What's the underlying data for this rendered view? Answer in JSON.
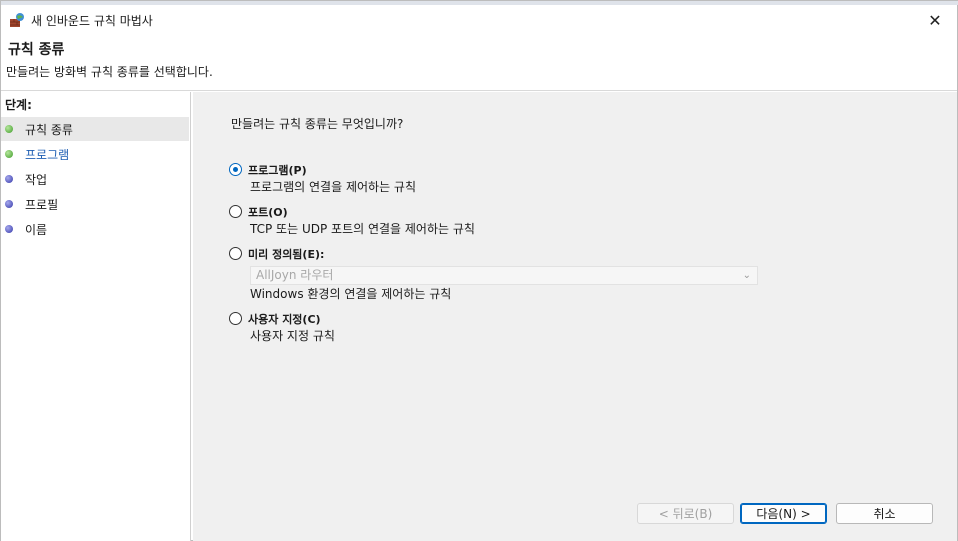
{
  "window": {
    "title": "새 인바운드 규칙 마법사",
    "close_label": "✕"
  },
  "header": {
    "title": "규칙 종류",
    "description": "만들려는 방화벽 규칙 종류를 선택합니다."
  },
  "steps": {
    "title": "단계:",
    "items": [
      {
        "label": "규칙 종류",
        "status": "done"
      },
      {
        "label": "프로그램",
        "status": "done"
      },
      {
        "label": "작업",
        "status": "pending"
      },
      {
        "label": "프로필",
        "status": "pending"
      },
      {
        "label": "이름",
        "status": "pending"
      }
    ]
  },
  "main": {
    "question": "만들려는 규칙 종류는 무엇입니까?",
    "options": [
      {
        "label": "프로그램(P)",
        "description": "프로그램의 연결을 제어하는 규칙",
        "checked": true
      },
      {
        "label": "포트(O)",
        "description": "TCP 또는 UDP 포트의 연결을 제어하는 규칙",
        "checked": false
      },
      {
        "label": "미리 정의됨(E):",
        "description": "Windows 환경의 연결을 제어하는 규칙",
        "checked": false
      },
      {
        "label": "사용자 지정(C)",
        "description": "사용자 지정 규칙",
        "checked": false
      }
    ],
    "predefined_select": {
      "value": "AllJoyn 라우터",
      "enabled": false
    }
  },
  "buttons": {
    "back": "< 뒤로(B)",
    "next": "다음(N) >",
    "cancel": "취소"
  },
  "colors": {
    "accent": "#0067c0",
    "done_dot": "#3f9b2a",
    "pending_dot": "#3337a8",
    "link_text": "#1f5fb3"
  }
}
